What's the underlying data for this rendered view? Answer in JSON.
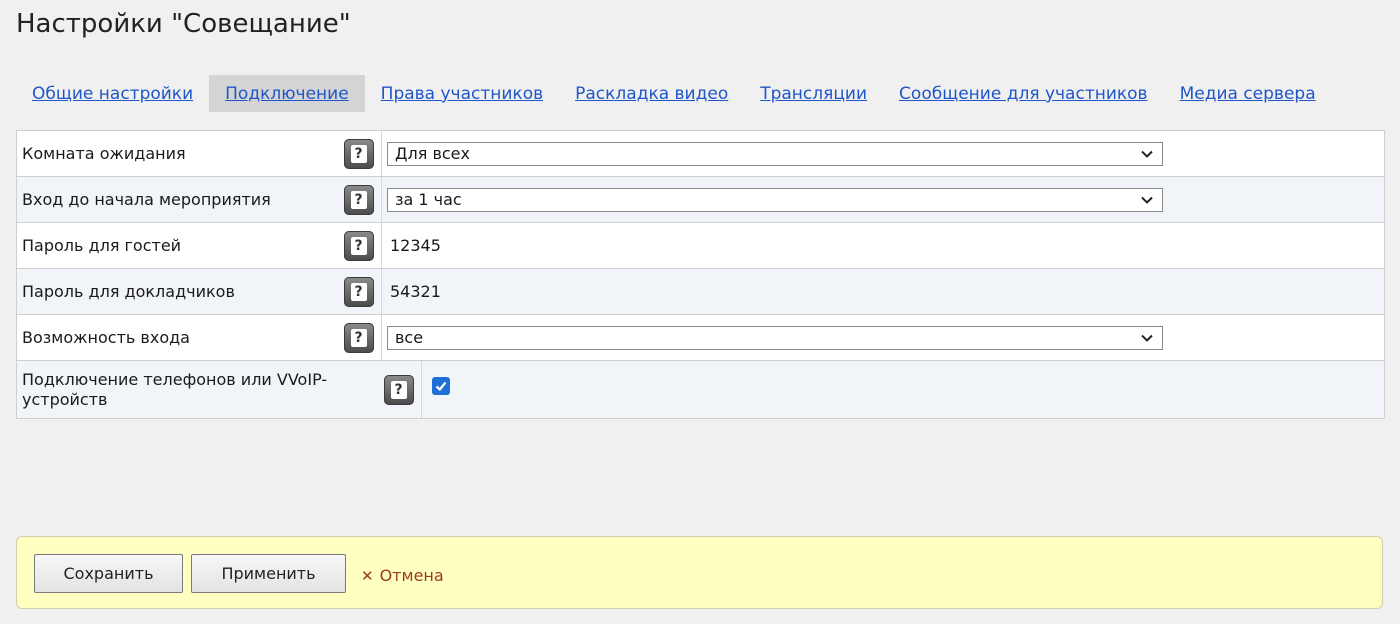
{
  "page": {
    "title": "Настройки \"Совещание\""
  },
  "tabs": [
    {
      "label": "Общие настройки",
      "active": false
    },
    {
      "label": "Подключение",
      "active": true
    },
    {
      "label": "Права участников",
      "active": false
    },
    {
      "label": "Раскладка видео",
      "active": false
    },
    {
      "label": "Трансляции",
      "active": false
    },
    {
      "label": "Сообщение для участников",
      "active": false
    },
    {
      "label": "Медиа сервера",
      "active": false
    }
  ],
  "settings": {
    "waiting_room": {
      "label": "Комната ожидания",
      "value": "Для всех"
    },
    "entry_before_start": {
      "label": "Вход до начала мероприятия",
      "value": "за 1 час"
    },
    "guest_password": {
      "label": "Пароль для гостей",
      "value": "12345"
    },
    "speaker_password": {
      "label": "Пароль для докладчиков",
      "value": "54321"
    },
    "entry_possibility": {
      "label": "Возможность входа",
      "value": "все"
    },
    "phone_voip": {
      "label": "Подключение телефонов или VVoIP-устройств",
      "checked": true
    }
  },
  "help_icon": {
    "glyph": "?",
    "icon": "question-mark-icon"
  },
  "footer": {
    "save_label": "Сохранить",
    "apply_label": "Применить",
    "cancel_label": "Отмена",
    "cancel_icon": "✕"
  },
  "colors": {
    "link": "#1f56c8",
    "active_tab_bg": "#d4d4d4",
    "footer_bg": "#ffffc2",
    "cancel": "#9c3c1c",
    "checkbox": "#1f6fd8"
  }
}
